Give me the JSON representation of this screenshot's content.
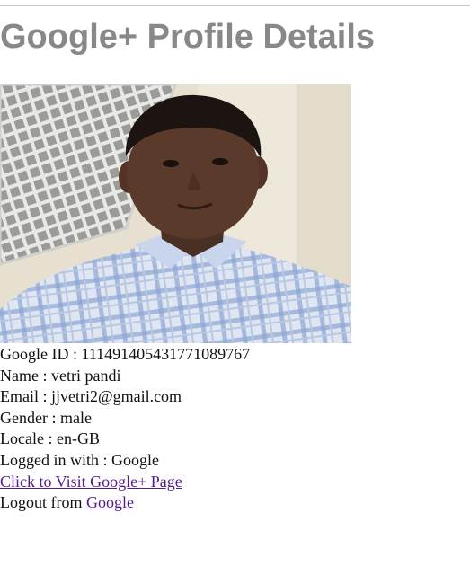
{
  "page": {
    "title": "Google+ Profile Details"
  },
  "profile": {
    "photo_icon": "profile-photo",
    "fields": {
      "google_id": {
        "label": "Google ID",
        "value": "111491405431771089767"
      },
      "name": {
        "label": "Name",
        "value": "vetri pandi"
      },
      "email": {
        "label": "Email",
        "value": "jjvetri2@gmail.com"
      },
      "gender": {
        "label": "Gender",
        "value": "male"
      },
      "locale": {
        "label": "Locale",
        "value": "en-GB"
      },
      "logged_in_with": {
        "label": "Logged in with",
        "value": "Google"
      }
    },
    "separator": " : ",
    "visit_link_text": "Click to Visit Google+ Page",
    "logout_prefix": "Logout from ",
    "logout_link_text": "Google"
  },
  "colors": {
    "title": "#888888",
    "link": "#551a8b",
    "text": "#111111"
  }
}
